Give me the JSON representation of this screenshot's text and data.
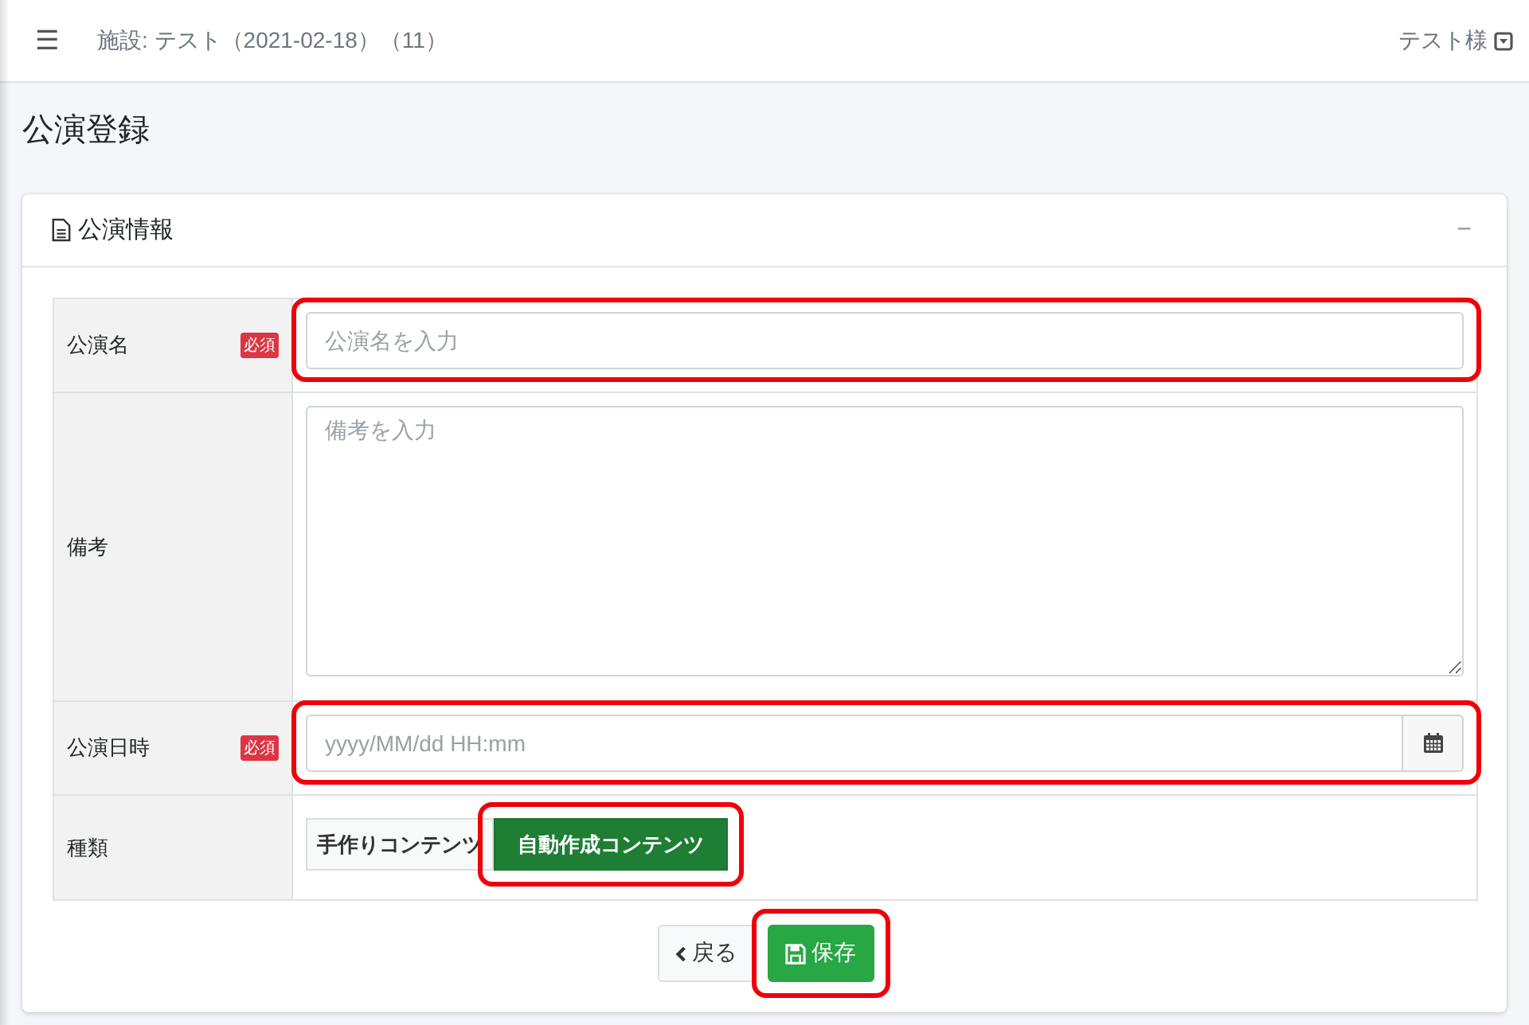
{
  "topbar": {
    "menu_icon": "☰",
    "facility": "施設: テスト（2021-02-18）（11）",
    "user": "テスト様"
  },
  "page_title": "公演登録",
  "card": {
    "title": "公演情報",
    "collapse": "−"
  },
  "form": {
    "rows": [
      {
        "kind": "text",
        "label": "公演名",
        "required": true,
        "badge": "必須",
        "placeholder": "公演名を入力",
        "highlighted": true
      },
      {
        "kind": "textarea",
        "label": "備考",
        "required": false,
        "placeholder": "備考を入力",
        "highlighted": false
      },
      {
        "kind": "datetime",
        "label": "公演日時",
        "required": true,
        "badge": "必須",
        "placeholder": "yyyy/MM/dd HH:mm",
        "highlighted": true
      },
      {
        "kind": "toggle",
        "label": "種類",
        "required": false,
        "options": [
          {
            "label": "手作りコンテンツ",
            "selected": false,
            "highlighted": false
          },
          {
            "label": "自動作成コンテンツ",
            "selected": true,
            "highlighted": true
          }
        ]
      }
    ]
  },
  "actions": [
    {
      "kind": "back",
      "label": "戻る",
      "highlighted": false
    },
    {
      "kind": "save",
      "label": "保存",
      "highlighted": true
    }
  ]
}
